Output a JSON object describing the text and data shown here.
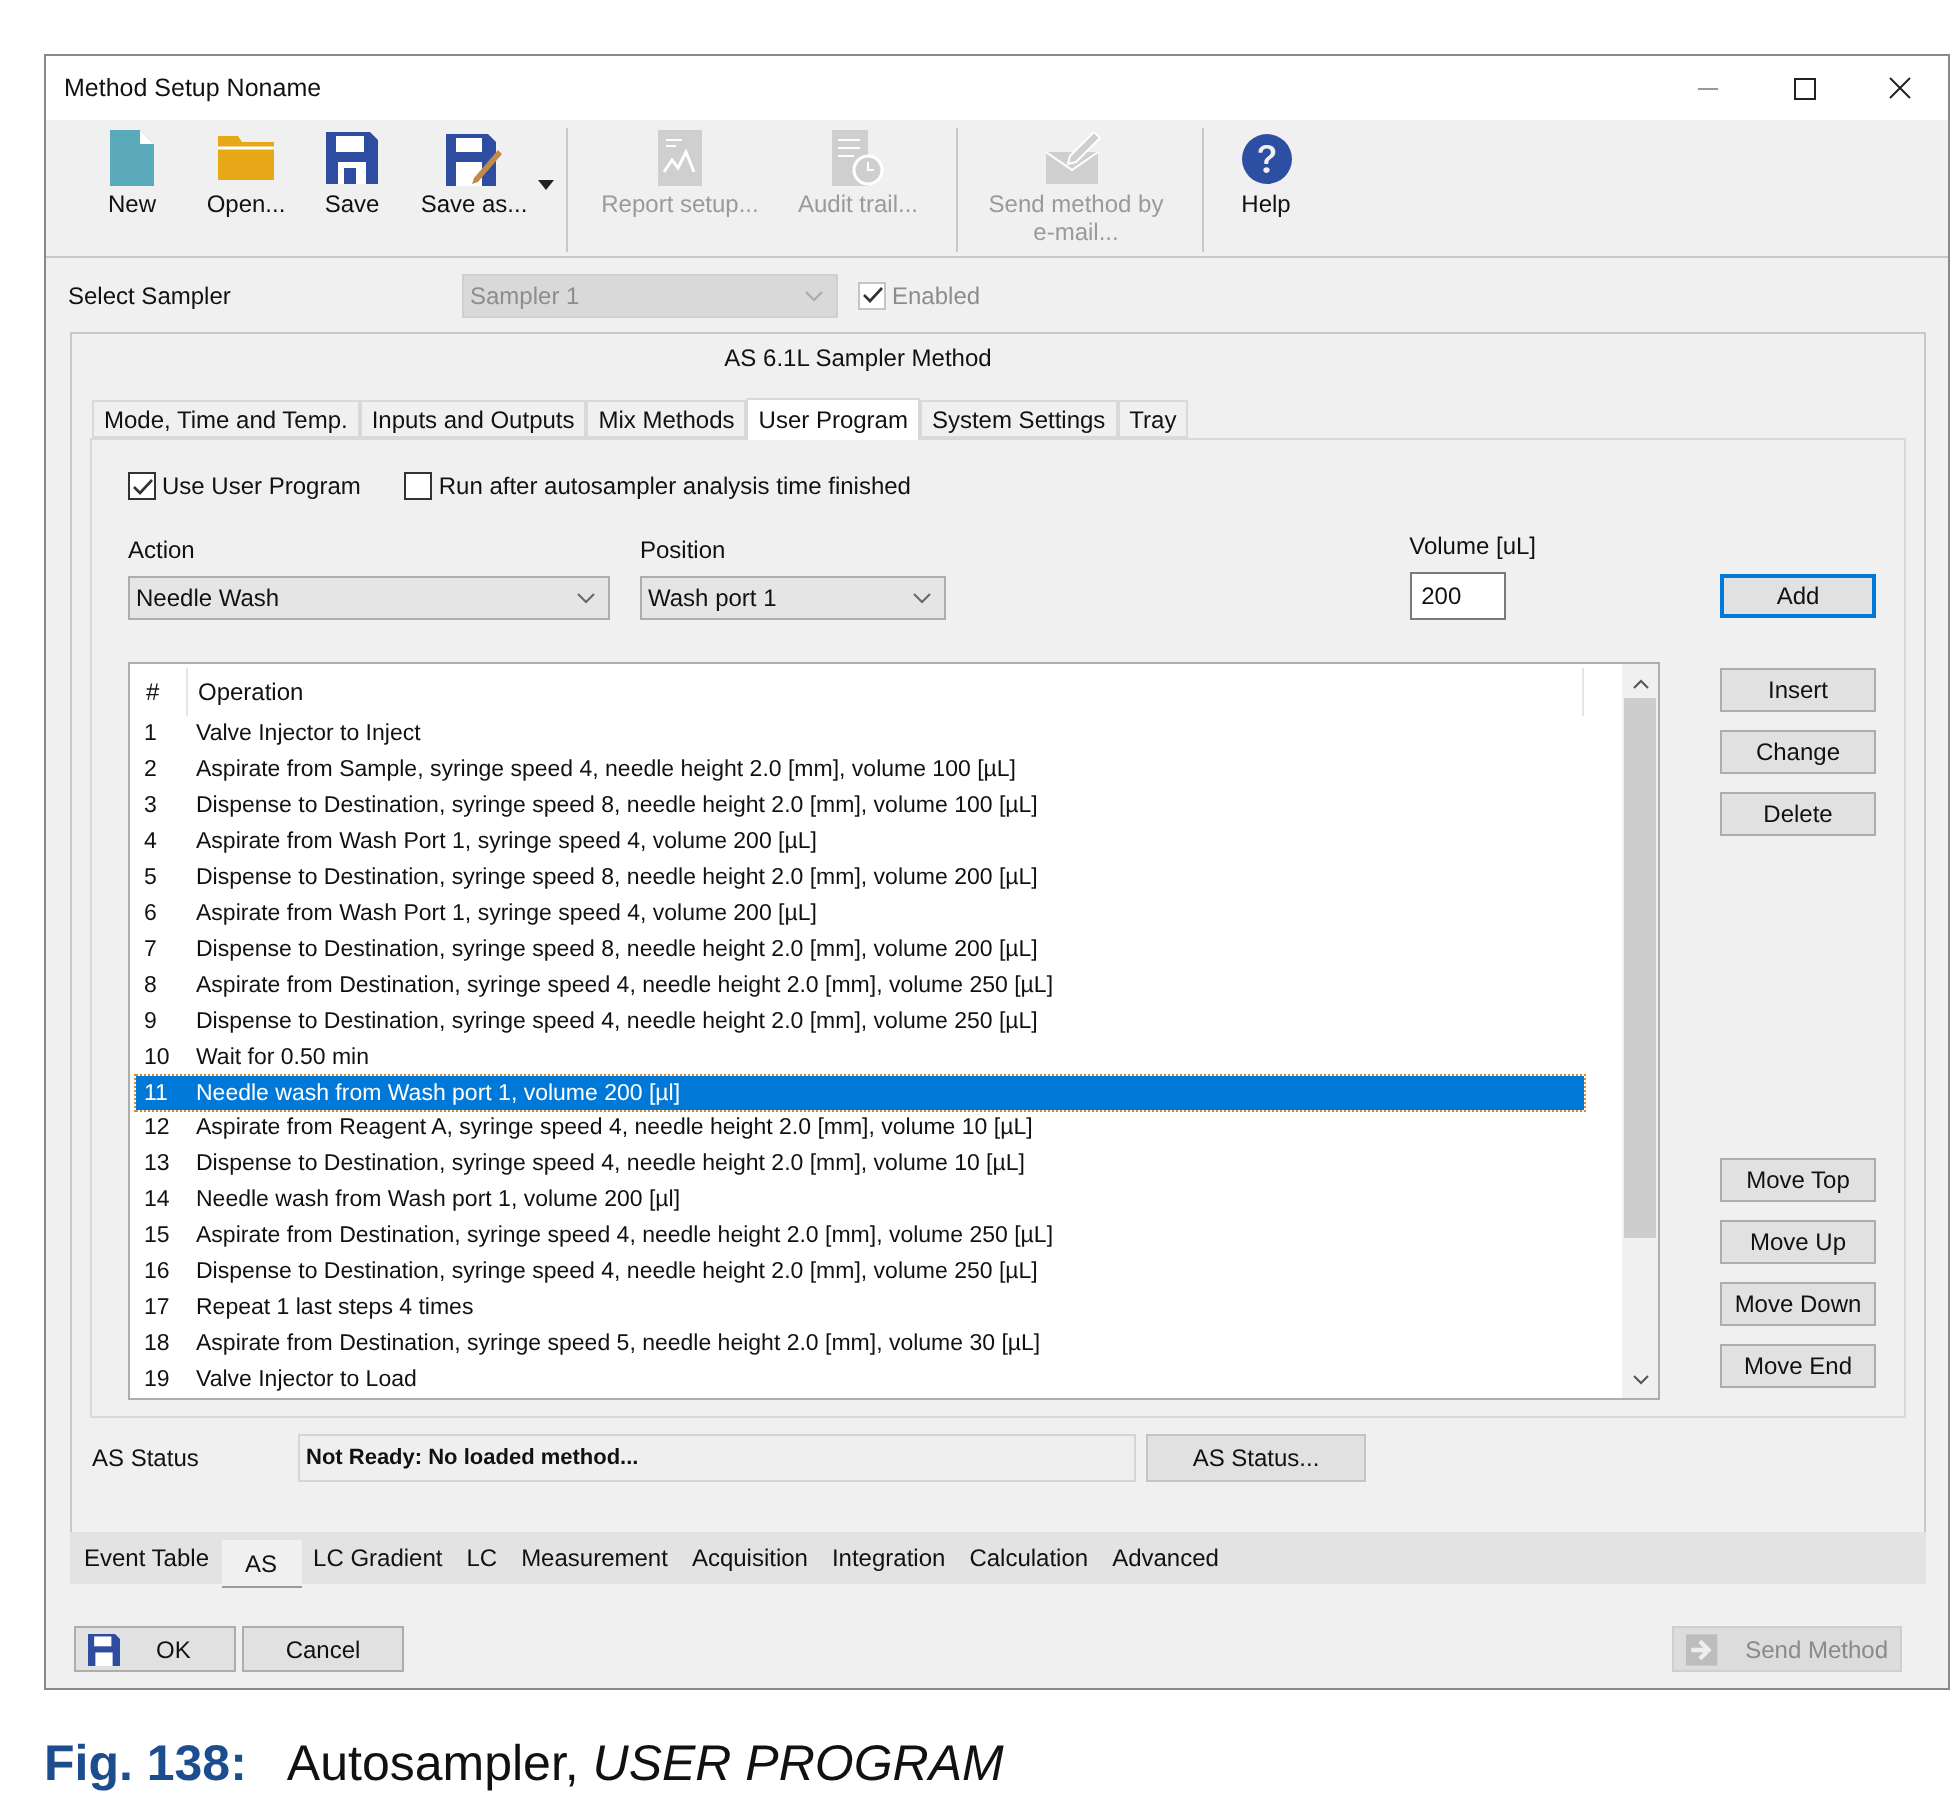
{
  "window": {
    "title": "Method Setup Noname"
  },
  "toolbar_groups": [
    [
      {
        "kind": "new",
        "label": "New",
        "disabled": false,
        "dropdown": false
      },
      {
        "kind": "open",
        "label": "Open...",
        "disabled": false,
        "dropdown": false
      },
      {
        "kind": "save",
        "label": "Save",
        "disabled": false,
        "dropdown": false
      },
      {
        "kind": "save_as",
        "label": "Save as...",
        "disabled": false,
        "dropdown": true
      }
    ],
    [
      {
        "kind": "report",
        "label": "Report setup...",
        "disabled": true,
        "dropdown": false
      },
      {
        "kind": "audit",
        "label": "Audit trail...",
        "disabled": true,
        "dropdown": false
      }
    ],
    [
      {
        "kind": "email",
        "label": "Send method by e-mail...",
        "disabled": true,
        "dropdown": false
      }
    ],
    [
      {
        "kind": "help",
        "label": "Help",
        "disabled": false,
        "dropdown": false
      }
    ]
  ],
  "sampler": {
    "label": "Select Sampler",
    "value": "Sampler 1",
    "disabled": true,
    "enabled": {
      "label": "Enabled",
      "checked": true,
      "disabled": true
    }
  },
  "panel": {
    "title": "AS 6.1L Sampler Method",
    "tabs": [
      {
        "label": "Mode, Time and Temp.",
        "selected": false
      },
      {
        "label": "Inputs and Outputs",
        "selected": false
      },
      {
        "label": "Mix Methods",
        "selected": false
      },
      {
        "label": "User Program",
        "selected": true
      },
      {
        "label": "System Settings",
        "selected": false
      },
      {
        "label": "Tray",
        "selected": false
      }
    ],
    "options": [
      {
        "label": "Use User Program",
        "checked": true
      },
      {
        "label": "Run after autosampler analysis time finished",
        "checked": false
      }
    ],
    "action": {
      "label": "Action",
      "value": "Needle Wash"
    },
    "position": {
      "label": "Position",
      "value": "Wash port 1"
    },
    "volume": {
      "label": "Volume [uL]",
      "value": "200"
    },
    "add_button": {
      "label": "Add",
      "focused": true
    },
    "table": {
      "columns": [
        "#",
        "Operation"
      ],
      "rows": [
        {
          "number": "1",
          "operation": "Valve Injector to Inject",
          "selected": false
        },
        {
          "number": "2",
          "operation": "Aspirate from Sample, syringe speed 4, needle height 2.0 [mm], volume 100 [µL]",
          "selected": false
        },
        {
          "number": "3",
          "operation": "Dispense to Destination, syringe speed 8, needle height 2.0 [mm], volume 100 [µL]",
          "selected": false
        },
        {
          "number": "4",
          "operation": "Aspirate from Wash Port 1, syringe speed 4, volume 200 [µL]",
          "selected": false
        },
        {
          "number": "5",
          "operation": "Dispense to Destination, syringe speed 8, needle height 2.0 [mm], volume 200 [µL]",
          "selected": false
        },
        {
          "number": "6",
          "operation": "Aspirate from Wash Port 1, syringe speed 4, volume 200 [µL]",
          "selected": false
        },
        {
          "number": "7",
          "operation": "Dispense to Destination, syringe speed 8, needle height 2.0 [mm], volume 200 [µL]",
          "selected": false
        },
        {
          "number": "8",
          "operation": "Aspirate from Destination, syringe speed 4, needle height 2.0 [mm], volume 250 [µL]",
          "selected": false
        },
        {
          "number": "9",
          "operation": "Dispense to Destination, syringe speed 4, needle height 2.0 [mm], volume 250 [µL]",
          "selected": false
        },
        {
          "number": "10",
          "operation": "Wait for 0.50 min",
          "selected": false
        },
        {
          "number": "11",
          "operation": "Needle wash from Wash port 1, volume 200 [µl]",
          "selected": true
        },
        {
          "number": "12",
          "operation": "Aspirate from Reagent A, syringe speed 4, needle height 2.0 [mm], volume 10 [µL]",
          "selected": false
        },
        {
          "number": "13",
          "operation": "Dispense to Destination, syringe speed 4, needle height 2.0 [mm], volume 10 [µL]",
          "selected": false
        },
        {
          "number": "14",
          "operation": "Needle wash from Wash port 1, volume 200 [µl]",
          "selected": false
        },
        {
          "number": "15",
          "operation": "Aspirate from Destination, syringe speed 4, needle height 2.0 [mm], volume 250 [µL]",
          "selected": false
        },
        {
          "number": "16",
          "operation": "Dispense to Destination, syringe speed 4, needle height 2.0 [mm], volume 250 [µL]",
          "selected": false
        },
        {
          "number": "17",
          "operation": "Repeat 1 last steps 4 times",
          "selected": false
        },
        {
          "number": "18",
          "operation": "Aspirate from Destination, syringe speed 5, needle height 2.0 [mm], volume 30 [µL]",
          "selected": false
        },
        {
          "number": "19",
          "operation": "Valve Injector to Load",
          "selected": false
        }
      ]
    },
    "edit_buttons": [
      "Insert",
      "Change",
      "Delete"
    ],
    "move_buttons": [
      "Move Top",
      "Move Up",
      "Move Down",
      "Move End"
    ],
    "status": {
      "label": "AS Status",
      "value": "Not Ready: No loaded method...",
      "button": "AS Status..."
    }
  },
  "bottom_tabs": [
    {
      "label": "Event Table",
      "selected": false
    },
    {
      "label": "AS",
      "selected": true
    },
    {
      "label": "LC Gradient",
      "selected": false
    },
    {
      "label": "LC",
      "selected": false
    },
    {
      "label": "Measurement",
      "selected": false
    },
    {
      "label": "Acquisition",
      "selected": false
    },
    {
      "label": "Integration",
      "selected": false
    },
    {
      "label": "Calculation",
      "selected": false
    },
    {
      "label": "Advanced",
      "selected": false
    }
  ],
  "footer": {
    "buttons": [
      {
        "kind": "ok",
        "label": "OK",
        "disabled": false
      },
      {
        "kind": "cancel",
        "label": "Cancel",
        "disabled": false
      },
      {
        "kind": "send",
        "label": "Send Method",
        "disabled": true
      }
    ]
  },
  "caption": {
    "number": "Fig. 138:",
    "text": "Autosampler, *USER PROGRAM*"
  }
}
